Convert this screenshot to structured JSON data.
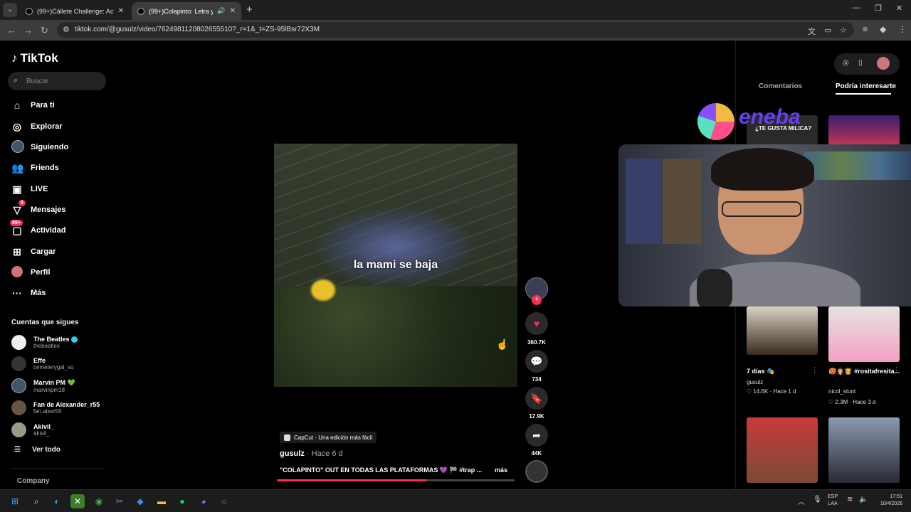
{
  "browser": {
    "tabs": [
      {
        "title": "(99+)Cállete Challenge: Actuació",
        "active": false
      },
      {
        "title": "(99+)Colapinto: Letra y Mú",
        "active": true
      }
    ],
    "url": "tiktok.com/@gusulz/video/7624981120802655510?_r=1&_t=ZS-95lBsr72X3M"
  },
  "sidebar": {
    "logo": "TikTok",
    "search_placeholder": "Buscar",
    "nav": [
      {
        "label": "Para ti",
        "icon": "home-icon"
      },
      {
        "label": "Explorar",
        "icon": "compass-icon"
      },
      {
        "label": "Siguiendo",
        "icon": "following-avatar-icon"
      },
      {
        "label": "Friends",
        "icon": "friends-icon"
      },
      {
        "label": "LIVE",
        "icon": "live-icon"
      },
      {
        "label": "Mensajes",
        "icon": "send-icon",
        "badge": "8"
      },
      {
        "label": "Actividad",
        "icon": "activity-icon",
        "badge": "99+"
      },
      {
        "label": "Cargar",
        "icon": "upload-icon"
      },
      {
        "label": "Perfil",
        "icon": "profile-avatar-icon"
      },
      {
        "label": "Más",
        "icon": "more-icon"
      }
    ],
    "following_title": "Cuentas que sigues",
    "accounts": [
      {
        "name": "The Beatles",
        "handle": "thebeatles",
        "verified": true
      },
      {
        "name": "Effe",
        "handle": "cemeterygal_vu"
      },
      {
        "name": "Marvin PM 💚",
        "handle": "marvinpm18"
      },
      {
        "name": "Fan de Alexander_r55",
        "handle": "fan.alexr55"
      },
      {
        "name": "Akivil_",
        "handle": "akivil_"
      }
    ],
    "see_all": "Ver todo",
    "company": "Company"
  },
  "video": {
    "caption": "la mami se baja",
    "capcut": "CapCut · Una edición más fácil",
    "author": "gusulz",
    "ago": "· Hace 6 d",
    "description": "\"COLAPINTO\" OUT EN TODAS LAS PLATAFORMAS 💜 🏁 #trap ...",
    "more": "más",
    "progress": 0.63,
    "likes": "360.7K",
    "comments": "734",
    "saves": "17.9K",
    "shares": "44K"
  },
  "right_panel": {
    "tab_comments": "Comentarios",
    "tab_suggested": "Podría interesarte",
    "cards": [
      {
        "title": "7 días 🎭",
        "user": "gusulz",
        "likes": "♡ 14.6K",
        "ago": "· Hace 1 d"
      },
      {
        "title": "🥵🧛👸 #rositafresita...",
        "user": "nicol_stunt",
        "likes": "♡ 2.3M",
        "ago": "· Hace 3 d"
      }
    ],
    "top_thumb_text": "¿TE GUSTA MILICA?"
  },
  "overlay": {
    "sponsor": "eneba"
  },
  "taskbar": {
    "lang_top": "ESP",
    "lang_bottom": "LAA",
    "time": "17:51",
    "date": "10/4/2026"
  }
}
